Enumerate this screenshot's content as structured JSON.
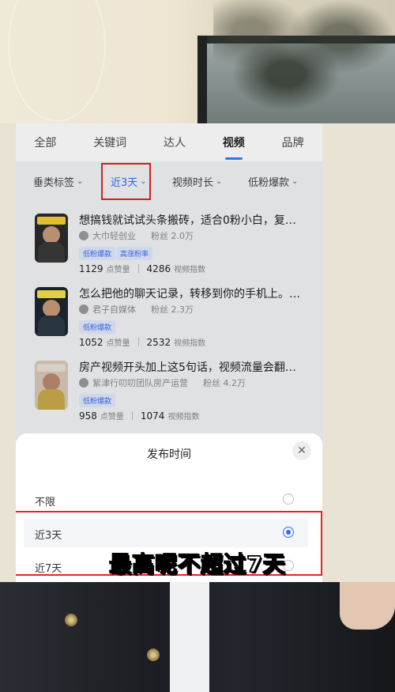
{
  "tabs": [
    {
      "label": "全部"
    },
    {
      "label": "关键词"
    },
    {
      "label": "达人"
    },
    {
      "label": "视频"
    },
    {
      "label": "品牌"
    }
  ],
  "active_tab": "视频",
  "filters": [
    {
      "label": "垂类标签"
    },
    {
      "label": "近3天"
    },
    {
      "label": "视频时长"
    },
    {
      "label": "低粉爆款"
    }
  ],
  "chevron_glyph": "⌄",
  "videos": [
    {
      "title": "想搞钱就试试头条搬砖，适合0粉小白，复…",
      "author": "大巾轻创业",
      "fans": "粉丝 2.0万",
      "tags": [
        "低粉爆款",
        "高涨粉率"
      ],
      "likes": "1129",
      "likes_label": "点赞量",
      "index": "4286",
      "index_label": "视频指数",
      "thumb_color": "#2b2b2b"
    },
    {
      "title": "怎么把他的聊天记录，转移到你的手机上。…",
      "author": "君子自媒体",
      "fans": "粉丝 2.3万",
      "tags": [
        "低粉爆款"
      ],
      "likes": "1052",
      "likes_label": "点赞量",
      "index": "2532",
      "index_label": "视频指数",
      "thumb_color": "#1d2630"
    },
    {
      "title": "房产视频开头加上这5句话，视频流量会翻…",
      "author": "絮津行叨叨团队房产运营",
      "fans": "粉丝 4.2万",
      "tags": [
        "低粉爆款"
      ],
      "likes": "958",
      "likes_label": "点赞量",
      "index": "1074",
      "index_label": "视频指数",
      "thumb_color": "#d9c7b8"
    }
  ],
  "sheet": {
    "title": "发布时间",
    "close_glyph": "✕",
    "options": [
      {
        "label": "不限",
        "selected": false
      },
      {
        "label": "近3天",
        "selected": true
      },
      {
        "label": "近7天",
        "selected": false
      }
    ]
  },
  "subtitle": "最高呢不超过7天",
  "colors": {
    "accent": "#2f6bff",
    "highlight_box": "#e52420",
    "tag_bg": "#dfe8fd"
  }
}
